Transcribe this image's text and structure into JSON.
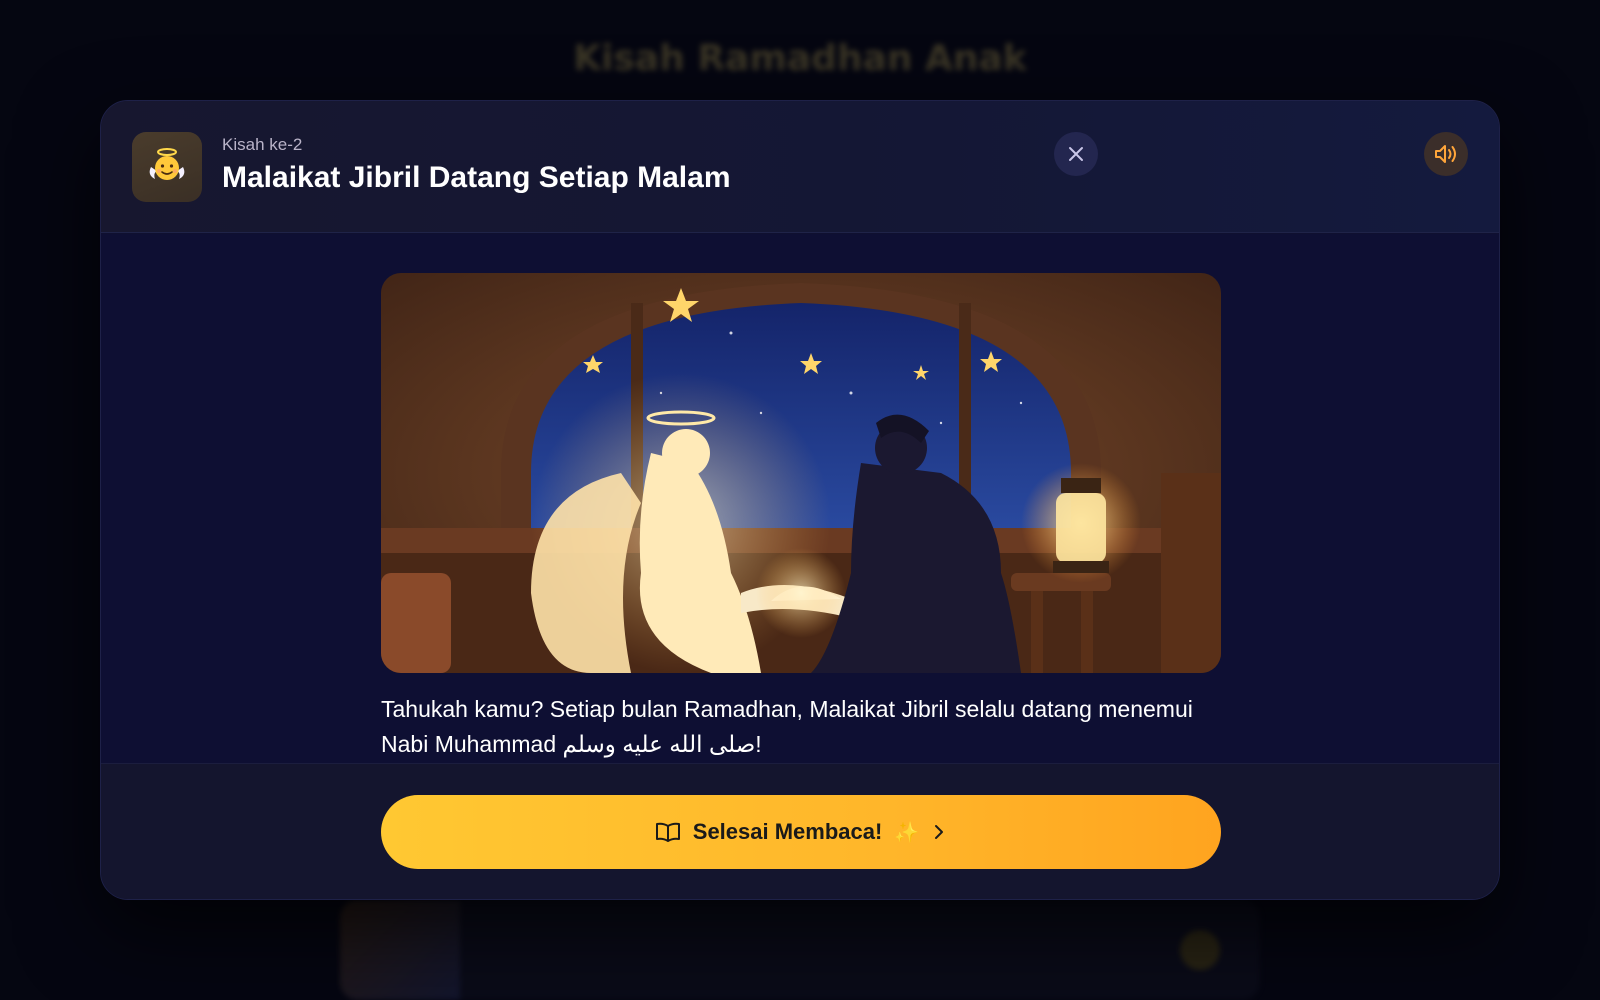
{
  "background": {
    "page_title": "Kisah Ramadhan Anak"
  },
  "modal": {
    "story_number": "Kisah ke-2",
    "story_title": "Malaikat Jibril Datang Setiap Malam",
    "story_icon": "angel-emoji-icon",
    "close_icon": "close-icon",
    "sound_icon": "volume-icon",
    "illustration": "angel-jibril-and-prophet-reading-scene",
    "story_text": "Tahukah kamu? Setiap bulan Ramadhan, Malaikat Jibril selalu datang menemui Nabi Muhammad صلى الله عليه وسلم!",
    "finish_button": {
      "label": "Selesai Membaca!",
      "sparkle": "✨",
      "icon_left": "book-open-icon",
      "icon_right": "chevron-right-icon"
    }
  },
  "colors": {
    "modal_bg": "#0f1030",
    "accent": "#ffb62a",
    "close_bg": "#23264f",
    "sound_bg": "#3b2e2a",
    "sound_icon": "#ffa53a"
  }
}
